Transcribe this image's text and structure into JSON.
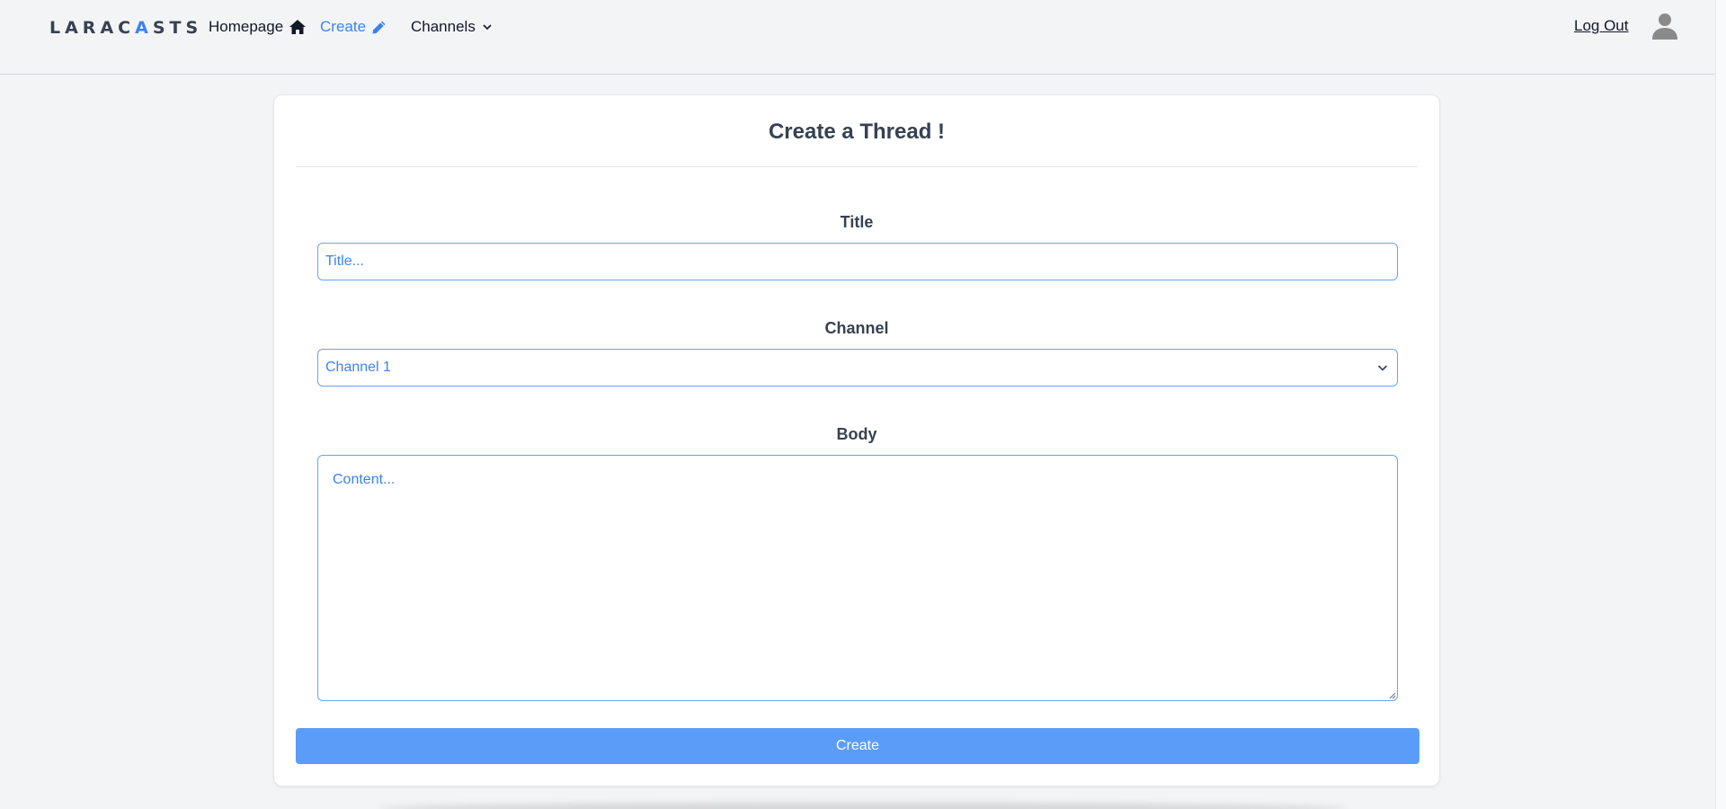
{
  "navbar": {
    "logo_left": "LARAC",
    "logo_accent": "A",
    "logo_right": "STS",
    "links": [
      {
        "label": "Homepage",
        "icon": "home-icon"
      },
      {
        "label": "Create",
        "icon": "pencil-icon"
      },
      {
        "label": "Channels",
        "icon": "chevron-down-icon"
      }
    ],
    "logout_label": "Log Out",
    "avatar_icon": "user-avatar-icon"
  },
  "form": {
    "heading": "Create a Thread !",
    "title_label": "Title",
    "title_placeholder": "Title...",
    "title_value": "",
    "channel_label": "Channel",
    "channel_selected": "Channel 1",
    "body_label": "Body",
    "body_placeholder": "Content...",
    "body_value": "",
    "submit_label": "Create"
  },
  "colors": {
    "accent": "#3b82f6",
    "button": "#5b9cf8",
    "background": "#f3f4f6"
  }
}
